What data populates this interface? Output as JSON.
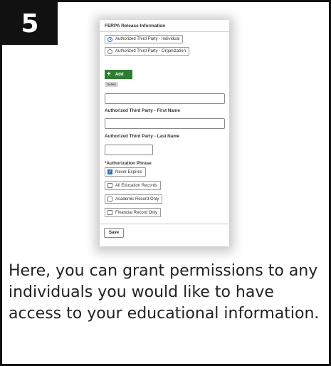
{
  "step": {
    "number": "5"
  },
  "form": {
    "section_title": "FERPA Release Information",
    "radio_options": [
      {
        "label": "Authorized Third Party - Individual",
        "selected": true
      },
      {
        "label": "Authorized Third Party - Organization",
        "selected": false
      }
    ],
    "add_label": "Add",
    "delete_label": "Delete",
    "first_name_label": "Authorized Third Party - First Name",
    "last_name_label": "Authorized Third Party - Last Name",
    "authorization_phrase_label": "*Authorization Phrase",
    "checkboxes": [
      {
        "label": "Never Expires",
        "checked": true
      },
      {
        "label": "All Education Records",
        "checked": false
      },
      {
        "label": "Academic Record Only",
        "checked": false
      },
      {
        "label": "Financial Record Only",
        "checked": false
      }
    ],
    "save_label": "Save"
  },
  "caption": {
    "text": "Here, you can grant permissions to any individuals you would like to have access to your educational information."
  },
  "colors": {
    "badge_bg": "#111111",
    "add_button": "#2e7d32",
    "checked_accent": "#2a6cc4"
  }
}
